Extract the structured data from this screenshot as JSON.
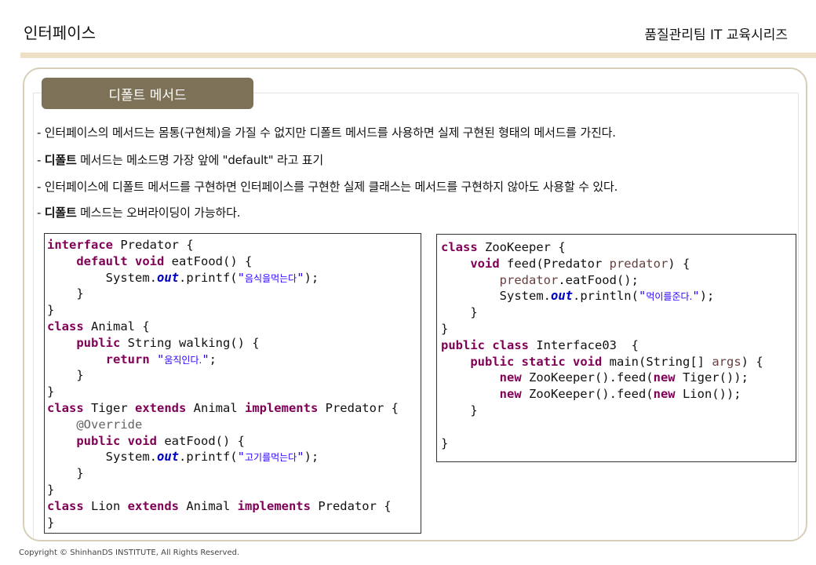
{
  "header": {
    "page_title": "인터페이스",
    "series_title": "품질관리팀 IT 교육시리즈"
  },
  "section": {
    "tab_label": "디폴트 메서드"
  },
  "bullets": {
    "b1": "- 인터페이스의 메서드는 몸통(구현체)을 가질 수 없지만 디폴트 메서드를 사용하면 실제 구현된 형태의 메서드를 가진다.",
    "b2_strong": "디폴트",
    "b2_rest": " 메서드는 메소드명 가장 앞에 \"default\" 라고 표기",
    "b3": "- 인터페이스에 디폴트 메서드를 구현하면  인터페이스를 구현한  실제 클래스는  메서드를 구현하지 않아도 사용할 수 있다.",
    "b4_strong": "디폴트",
    "b4_rest": " 메스드는 오버라이딩이 가능하다.",
    "dash": "- "
  },
  "code_left": {
    "kw_interface": "interface",
    "predator_open": " Predator {",
    "indent1": "    ",
    "indent2": "        ",
    "kw_default": "default",
    "kw_void": "void",
    "eatfood_decl": " eatFood() {",
    "system": "System.",
    "out": "out",
    "printf_open": ".printf(",
    "q": "\"",
    "str_eat": "음식을먹는다",
    "close_call": ");",
    "close_brace": "}",
    "kw_class": "class",
    "animal_open": " Animal {",
    "kw_public": "public",
    "walking_decl": " String walking() {",
    "kw_return": "return",
    "str_move": "움직인다.",
    "str_close": ";",
    "tiger_name": " Tiger ",
    "kw_extends": "extends",
    "animal_mid": " Animal ",
    "kw_implements": "implements",
    "predator_tail": " Predator {",
    "override": "@Override",
    "str_meat": "고기를먹는다",
    "lion_name": " Lion "
  },
  "code_right": {
    "kw_class": "class",
    "zoo_open": " ZooKeeper {",
    "kw_void": "void",
    "feed_decl": " feed(Predator ",
    "param": "predator",
    "feed_tail": ") {",
    "eat_call": ".eatFood();",
    "system": "System.",
    "out": "out",
    "println_open": ".println(",
    "q": "\"",
    "str_feed": "먹이를준다.",
    "close_call": ");",
    "close_brace": "}",
    "kw_public": "public",
    "iface_name": " Interface03  {",
    "kw_static": "static",
    "main_decl": " main(String[] ",
    "args": "args",
    "main_tail": ") {",
    "kw_new": "new",
    "zoo_ctor": " ZooKeeper().feed(",
    "tiger_tail": " Tiger());",
    "lion_tail": " Lion());"
  },
  "footer": {
    "copyright": "Copyright © ShinhanDS INSTITUTE, All Rights Reserved."
  },
  "colors": {
    "tab_bg": "#7d7258",
    "top_bar": "#eedfc7",
    "frame_border": "#d6ceb9",
    "keyword": "#7f0055",
    "string": "#2a00ff",
    "static_field": "#0000c0",
    "annotation": "#646464"
  }
}
